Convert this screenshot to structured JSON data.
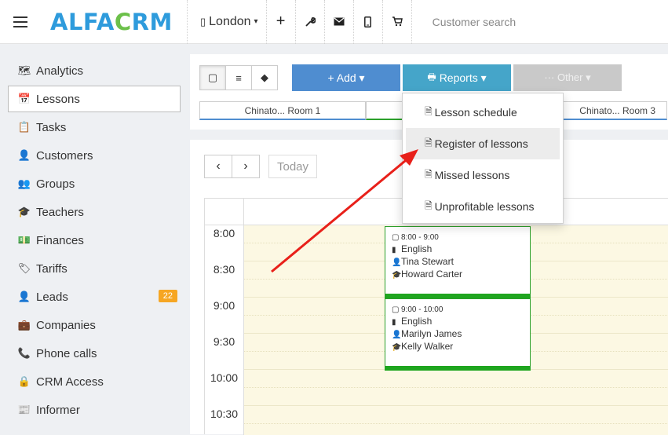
{
  "header": {
    "logo": {
      "part1": "ALFA",
      "part2": "C",
      "part3": "RM"
    },
    "branch": "London",
    "search_placeholder": "Customer search",
    "icons": [
      "plus-icon",
      "wrench-icon",
      "envelope-icon",
      "phone-icon",
      "cart-icon"
    ]
  },
  "sidebar": {
    "items": [
      {
        "label": "Analytics",
        "icon": "map-icon"
      },
      {
        "label": "Lessons",
        "icon": "calendar-icon"
      },
      {
        "label": "Tasks",
        "icon": "clipboard-icon"
      },
      {
        "label": "Customers",
        "icon": "user-icon"
      },
      {
        "label": "Groups",
        "icon": "users-icon"
      },
      {
        "label": "Teachers",
        "icon": "graduation-cap-icon"
      },
      {
        "label": "Finances",
        "icon": "money-icon"
      },
      {
        "label": "Tariffs",
        "icon": "tag-icon"
      },
      {
        "label": "Leads",
        "icon": "user-plus-icon",
        "badge": "22"
      },
      {
        "label": "Companies",
        "icon": "briefcase-icon"
      },
      {
        "label": "Phone calls",
        "icon": "phone-call-icon"
      },
      {
        "label": "CRM Access",
        "icon": "lock-icon"
      },
      {
        "label": "Informer",
        "icon": "newspaper-icon"
      }
    ]
  },
  "toolbar": {
    "add_label": "+ Add ▾",
    "reports_label": "Reports ▾",
    "other_label": "··· Other ▾",
    "rooms": [
      "Chinato... Room 1",
      "",
      "Chinato... Room 3"
    ]
  },
  "reports_menu": {
    "items": [
      "Lesson schedule",
      "Register of lessons",
      "Missed lessons",
      "Unprofitable lessons"
    ]
  },
  "calendar": {
    "today_label": "Today",
    "times": [
      "8:00",
      "8:30",
      "9:00",
      "9:30",
      "10:00",
      "10:30"
    ],
    "lessons": [
      {
        "time": "8:00 - 9:00",
        "subject": "English",
        "customer": "Tina Stewart",
        "teacher": "Howard Carter"
      },
      {
        "time": "9:00 - 10:00",
        "subject": "English",
        "customer": "Marilyn James",
        "teacher": "Kelly Walker"
      }
    ]
  },
  "colors": {
    "logo_blue": "#2e9bdc",
    "logo_green": "#6cc04a",
    "add_button": "#4f8dd0",
    "reports_button": "#45a5c9",
    "other_button": "#c9c9c9",
    "lesson_border": "#2ca02c",
    "slot_background": "#fcf8e3",
    "badge": "#f6a623",
    "annotation_arrow": "#e8201a"
  }
}
